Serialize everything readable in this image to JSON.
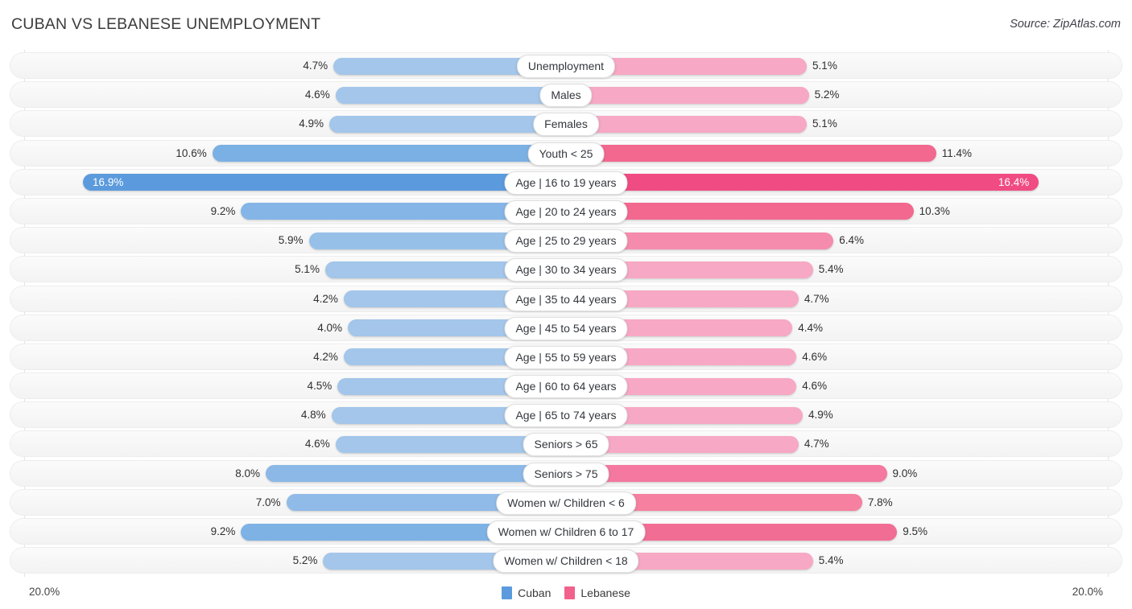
{
  "header": {
    "title": "CUBAN VS LEBANESE UNEMPLOYMENT",
    "source": "Source: ZipAtlas.com"
  },
  "footer": {
    "axis_left": "20.0%",
    "axis_right": "20.0%",
    "legend": [
      {
        "label": "Cuban",
        "color": "#5b9bdd",
        "icon": "legend-swatch"
      },
      {
        "label": "Lebanese",
        "color": "#f2618c",
        "icon": "legend-swatch"
      }
    ]
  },
  "chart_data": {
    "type": "bar",
    "orientation": "horizontal-diverging",
    "title": "CUBAN VS LEBANESE UNEMPLOYMENT",
    "xlabel": "",
    "ylabel": "",
    "xlim": [
      20.0,
      20.0
    ],
    "axis_max_left": 20.0,
    "axis_max_right": 20.0,
    "unit": "%",
    "grid": true,
    "legend_position": "bottom-center",
    "series": [
      {
        "name": "Cuban",
        "side": "left",
        "color": "#5b9bdd",
        "values": [
          4.7,
          4.6,
          4.9,
          10.6,
          16.9,
          9.2,
          5.9,
          5.1,
          4.2,
          4.0,
          4.2,
          4.5,
          4.8,
          4.6,
          8.0,
          7.0,
          9.2,
          5.2
        ]
      },
      {
        "name": "Lebanese",
        "side": "right",
        "color": "#f2618c",
        "values": [
          5.1,
          5.2,
          5.1,
          11.4,
          16.4,
          10.3,
          6.4,
          5.4,
          4.7,
          4.4,
          4.6,
          4.6,
          4.9,
          4.7,
          9.0,
          7.8,
          9.5,
          5.4
        ]
      }
    ],
    "categories": [
      "Unemployment",
      "Males",
      "Females",
      "Youth < 25",
      "Age | 16 to 19 years",
      "Age | 20 to 24 years",
      "Age | 25 to 29 years",
      "Age | 30 to 34 years",
      "Age | 35 to 44 years",
      "Age | 45 to 54 years",
      "Age | 55 to 59 years",
      "Age | 60 to 64 years",
      "Age | 65 to 74 years",
      "Seniors > 65",
      "Seniors > 75",
      "Women w/ Children < 6",
      "Women w/ Children 6 to 17",
      "Women w/ Children < 18"
    ]
  },
  "rows": [
    {
      "label": "Unemployment",
      "left_value": 4.7,
      "right_value": 5.1,
      "left_text": "4.7%",
      "right_text": "5.1%",
      "left_color": "#a3c6ea",
      "right_color": "#f7a8c4",
      "label_inside": false
    },
    {
      "label": "Males",
      "left_value": 4.6,
      "right_value": 5.2,
      "left_text": "4.6%",
      "right_text": "5.2%",
      "left_color": "#a3c6ea",
      "right_color": "#f7a8c4",
      "label_inside": false
    },
    {
      "label": "Females",
      "left_value": 4.9,
      "right_value": 5.1,
      "left_text": "4.9%",
      "right_text": "5.1%",
      "left_color": "#a3c6ea",
      "right_color": "#f7a8c4",
      "label_inside": false
    },
    {
      "label": "Youth < 25",
      "left_value": 10.6,
      "right_value": 11.4,
      "left_text": "10.6%",
      "right_text": "11.4%",
      "left_color": "#7bb0e4",
      "right_color": "#f2688f",
      "label_inside": false
    },
    {
      "label": "Age | 16 to 19 years",
      "left_value": 16.9,
      "right_value": 16.4,
      "left_text": "16.9%",
      "right_text": "16.4%",
      "left_color": "#5b9bdd",
      "right_color": "#f04b83",
      "label_inside": true
    },
    {
      "label": "Age | 20 to 24 years",
      "left_value": 9.2,
      "right_value": 10.3,
      "left_text": "9.2%",
      "right_text": "10.3%",
      "left_color": "#84b5e6",
      "right_color": "#f2688f",
      "label_inside": false
    },
    {
      "label": "Age | 25 to 29 years",
      "left_value": 5.9,
      "right_value": 6.4,
      "left_text": "5.9%",
      "right_text": "6.4%",
      "left_color": "#97c0e9",
      "right_color": "#f58cae",
      "label_inside": false
    },
    {
      "label": "Age | 30 to 34 years",
      "left_value": 5.1,
      "right_value": 5.4,
      "left_text": "5.1%",
      "right_text": "5.4%",
      "left_color": "#a3c6ea",
      "right_color": "#f7a8c4",
      "label_inside": false
    },
    {
      "label": "Age | 35 to 44 years",
      "left_value": 4.2,
      "right_value": 4.7,
      "left_text": "4.2%",
      "right_text": "4.7%",
      "left_color": "#a3c6ea",
      "right_color": "#f7a8c4",
      "label_inside": false
    },
    {
      "label": "Age | 45 to 54 years",
      "left_value": 4.0,
      "right_value": 4.4,
      "left_text": "4.0%",
      "right_text": "4.4%",
      "left_color": "#a3c6ea",
      "right_color": "#f7a8c4",
      "label_inside": false
    },
    {
      "label": "Age | 55 to 59 years",
      "left_value": 4.2,
      "right_value": 4.6,
      "left_text": "4.2%",
      "right_text": "4.6%",
      "left_color": "#a3c6ea",
      "right_color": "#f7a8c4",
      "label_inside": false
    },
    {
      "label": "Age | 60 to 64 years",
      "left_value": 4.5,
      "right_value": 4.6,
      "left_text": "4.5%",
      "right_text": "4.6%",
      "left_color": "#a3c6ea",
      "right_color": "#f7a8c4",
      "label_inside": false
    },
    {
      "label": "Age | 65 to 74 years",
      "left_value": 4.8,
      "right_value": 4.9,
      "left_text": "4.8%",
      "right_text": "4.9%",
      "left_color": "#a3c6ea",
      "right_color": "#f7a8c4",
      "label_inside": false
    },
    {
      "label": "Seniors > 65",
      "left_value": 4.6,
      "right_value": 4.7,
      "left_text": "4.6%",
      "right_text": "4.7%",
      "left_color": "#a3c6ea",
      "right_color": "#f7a8c4",
      "label_inside": false
    },
    {
      "label": "Seniors > 75",
      "left_value": 8.0,
      "right_value": 9.0,
      "left_text": "8.0%",
      "right_text": "9.0%",
      "left_color": "#8bb8e7",
      "right_color": "#f4789f",
      "label_inside": false
    },
    {
      "label": "Women w/ Children < 6",
      "left_value": 7.0,
      "right_value": 7.8,
      "left_text": "7.0%",
      "right_text": "7.8%",
      "left_color": "#90bbe8",
      "right_color": "#f5809f",
      "label_inside": false
    },
    {
      "label": "Women w/ Children 6 to 17",
      "left_value": 9.2,
      "right_value": 9.5,
      "left_text": "9.2%",
      "right_text": "9.5%",
      "left_color": "#7eb2e5",
      "right_color": "#f26d93",
      "label_inside": false
    },
    {
      "label": "Women w/ Children < 18",
      "left_value": 5.2,
      "right_value": 5.4,
      "left_text": "5.2%",
      "right_text": "5.4%",
      "left_color": "#a3c6ea",
      "right_color": "#f7a8c4",
      "label_inside": false
    }
  ]
}
